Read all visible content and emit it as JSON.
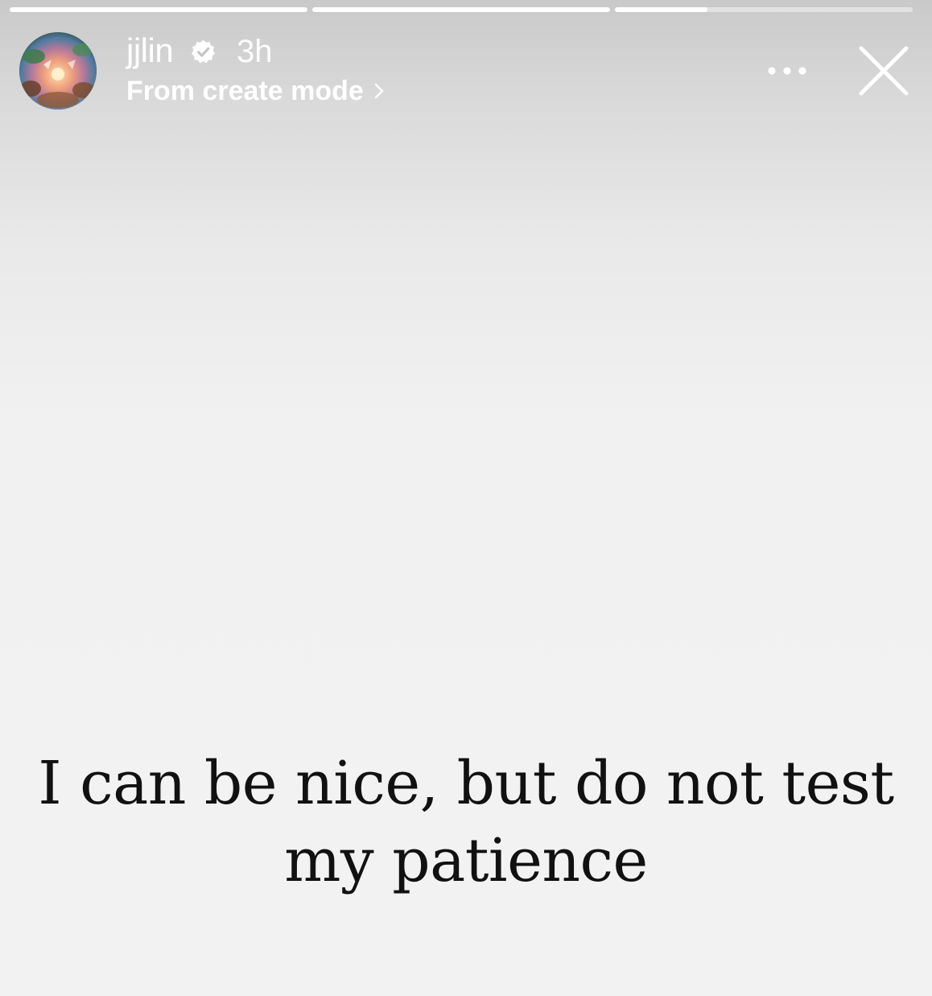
{
  "story": {
    "progress": [
      1.0,
      1.0,
      0.31
    ],
    "user": {
      "username": "jjlin",
      "verified": true,
      "time_ago": "3h",
      "subtitle": "From create mode"
    },
    "icons": {
      "verified": "verified-badge-icon",
      "more": "more-options-icon",
      "close": "close-icon",
      "chevron": "chevron-right-icon"
    },
    "caption": "I can be nice, but do not test my patience",
    "colors": {
      "background": "#f1f1f1",
      "text": "#111111",
      "header_text": "#ffffff"
    }
  }
}
